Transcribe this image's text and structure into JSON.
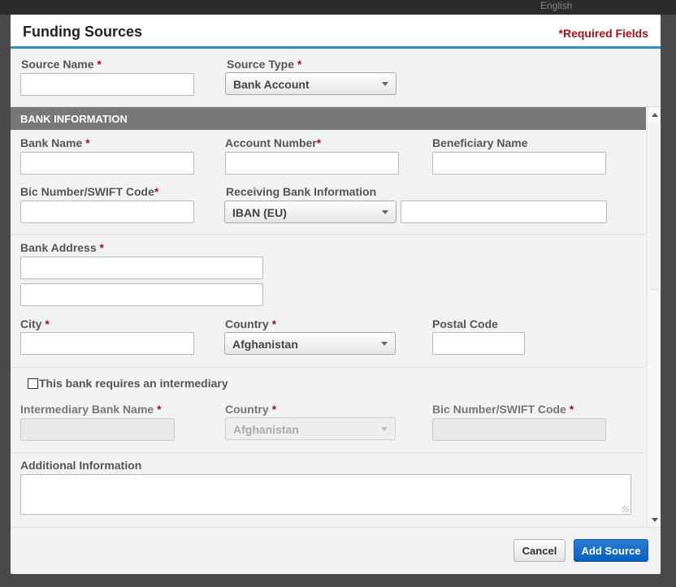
{
  "backdrop": {
    "language": "English"
  },
  "modal": {
    "title": "Funding Sources",
    "required_note": "*Required Fields"
  },
  "top": {
    "source_name_label": "Source Name",
    "source_type_label": "Source Type",
    "source_type_value": "Bank Account"
  },
  "bank": {
    "section_title": "BANK INFORMATION",
    "bank_name_label": "Bank Name",
    "account_number_label": "Account Number",
    "beneficiary_name_label": "Beneficiary Name",
    "bic_label": "Bic Number/SWIFT Code",
    "receiving_label": "Receiving Bank Information",
    "receiving_value": "IBAN (EU)",
    "address_label": "Bank Address",
    "city_label": "City",
    "country_label": "Country",
    "country_value": "Afghanistan",
    "postal_label": "Postal Code"
  },
  "intermediary": {
    "checkbox_label": "This bank requires an intermediary",
    "name_label": "Intermediary Bank Name",
    "country_label": "Country",
    "country_value": "Afghanistan",
    "bic_label": "Bic Number/SWIFT Code"
  },
  "additional": {
    "label": "Additional Information"
  },
  "footer": {
    "cancel_label": "Cancel",
    "add_label": "Add Source"
  },
  "required_mark": "*"
}
